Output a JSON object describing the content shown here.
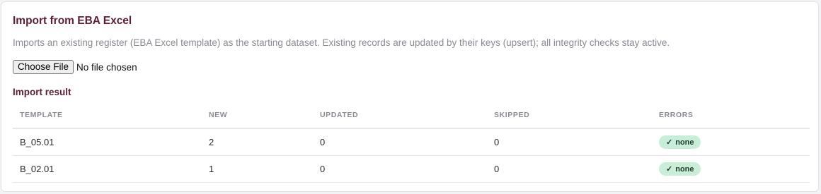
{
  "import_panel": {
    "title": "Import from EBA Excel",
    "description": "Imports an existing register (EBA Excel template) as the starting dataset. Existing records are updated by their keys (upsert); all integrity checks stay active.",
    "file_input": {
      "button_label": "Choose File",
      "status_text": "No file chosen"
    }
  },
  "import_result": {
    "title": "Import result",
    "columns": [
      "TEMPLATE",
      "NEW",
      "UPDATED",
      "SKIPPED",
      "ERRORS"
    ],
    "rows": [
      {
        "template": "B_05.01",
        "new": "2",
        "updated": "0",
        "skipped": "0",
        "errors": {
          "icon": "check-icon",
          "glyph": "✓",
          "label": "none",
          "color": "#c8eed7"
        }
      },
      {
        "template": "B_02.01",
        "new": "1",
        "updated": "0",
        "skipped": "0",
        "errors": {
          "icon": "check-icon",
          "glyph": "✓",
          "label": "none",
          "color": "#c8eed7"
        }
      }
    ]
  },
  "colors": {
    "accent": "#5c1f33",
    "muted_text": "#8a8a93",
    "success_badge": "#c8eed7"
  }
}
